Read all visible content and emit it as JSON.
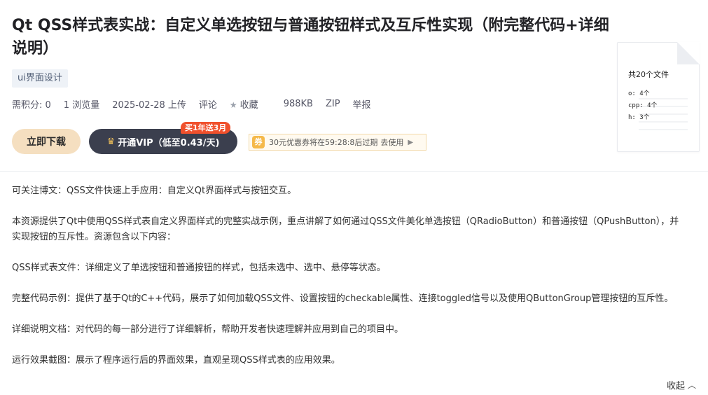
{
  "title": "Qt QSS样式表实战：自定义单选按钮与普通按钮样式及互斥性实现（附完整代码+详细说明）",
  "tag": "ui界面设计",
  "meta": {
    "points": "需积分: 0",
    "views": "1 浏览量",
    "date": "2025-02-28 上传",
    "comment": "评论",
    "collect": "收藏",
    "size": "988KB",
    "format": "ZIP",
    "report": "举报"
  },
  "actions": {
    "download_label": "立即下载",
    "vip_label": "开通VIP（低至0.43/天)",
    "vip_badge": "买1年送3月",
    "coupon_text": "30元优惠券将在59:28:8后过期",
    "coupon_link": "去使用"
  },
  "file_summary": {
    "total": "共20个文件",
    "items": [
      "o: 4个",
      "cpp: 4个",
      "h: 3个"
    ]
  },
  "description": [
    "可关注博文：QSS文件快速上手应用：自定义Qt界面样式与按钮交互。",
    "本资源提供了Qt中使用QSS样式表自定义界面样式的完整实战示例，重点讲解了如何通过QSS文件美化单选按钮（QRadioButton）和普通按钮（QPushButton），并实现按钮的互斥性。资源包含以下内容：",
    "QSS样式表文件：详细定义了单选按钮和普通按钮的样式，包括未选中、选中、悬停等状态。",
    "完整代码示例：提供了基于Qt的C++代码，展示了如何加载QSS文件、设置按钮的checkable属性、连接toggled信号以及使用QButtonGroup管理按钮的互斥性。",
    "详细说明文档：对代码的每一部分进行了详细解析，帮助开发者快速理解并应用到自己的项目中。",
    "运行效果截图：展示了程序运行后的界面效果，直观呈现QSS样式表的应用效果。"
  ],
  "collapse_label": "收起",
  "colors": {
    "download_bg": "#f5dfc0",
    "vip_bg": "#3b3f4e",
    "badge_bg": "#f0502c"
  }
}
